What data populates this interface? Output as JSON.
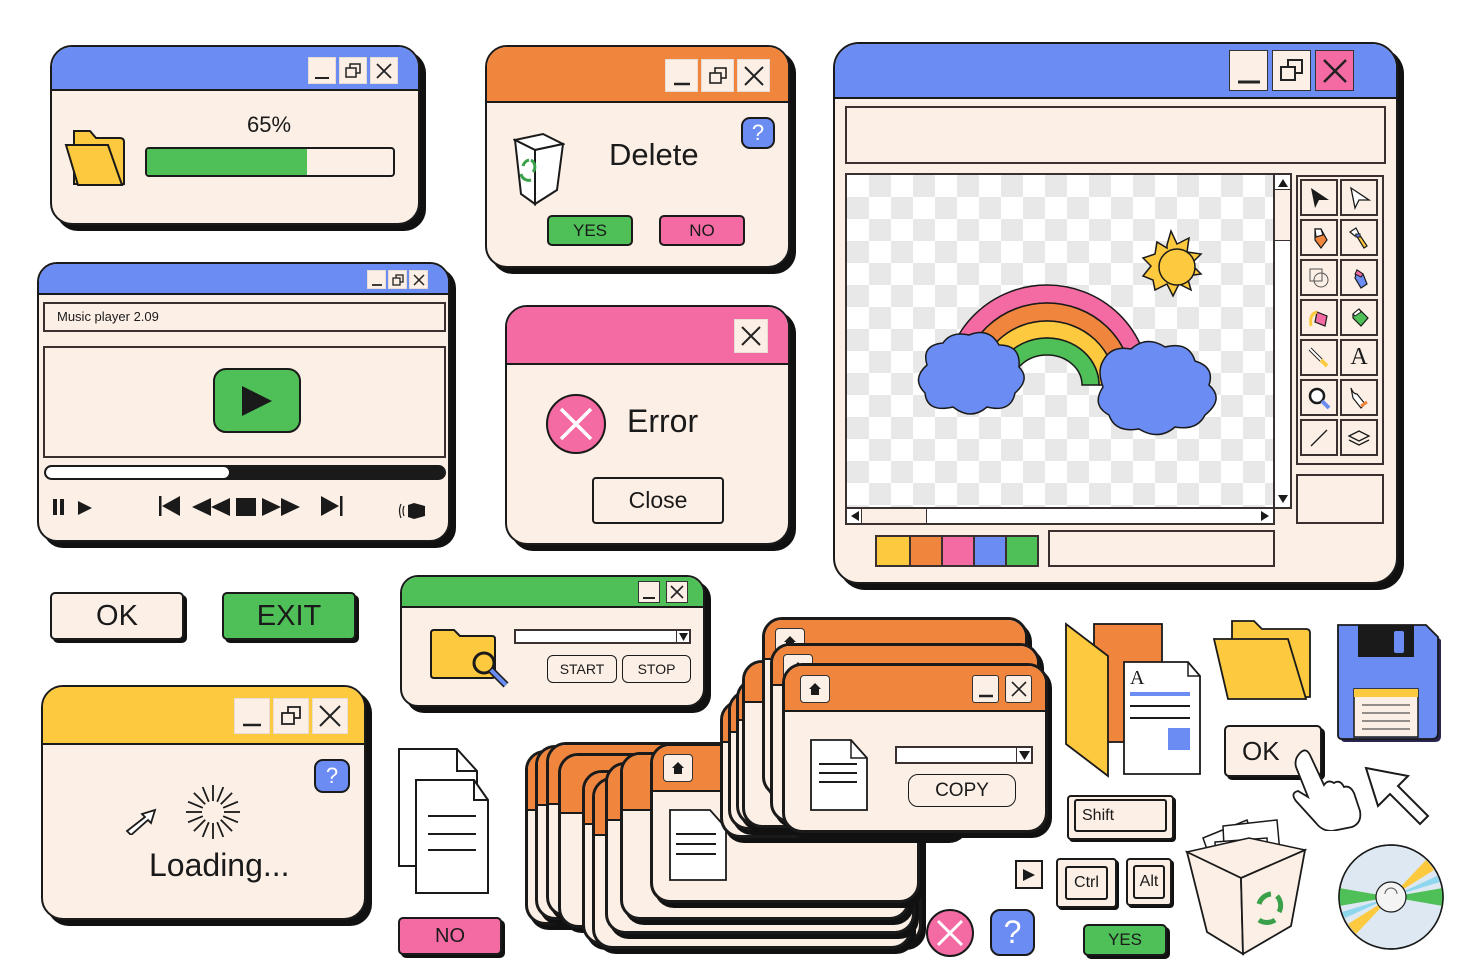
{
  "colors": {
    "blue": "#6b8cf2",
    "orange": "#f0853e",
    "pink": "#f46aa3",
    "yellow": "#fdc93f",
    "green": "#4fbf57",
    "cream": "#fcefe6",
    "outline": "#1a1a1a"
  },
  "progress_window": {
    "title_color": "#6b8cf2",
    "percent_label": "65%",
    "progress_value": 0.65,
    "icon": "folder-icon",
    "controls": [
      "minimize",
      "restore",
      "close"
    ]
  },
  "delete_dialog": {
    "title_color": "#f0853e",
    "message": "Delete",
    "help_label": "?",
    "yes_label": "YES",
    "no_label": "NO",
    "icon": "recycle-bin-icon",
    "controls": [
      "minimize",
      "restore",
      "close"
    ]
  },
  "music_player": {
    "title_color": "#6b8cf2",
    "track_title": "Music player 2.09",
    "progress_value": 0.46,
    "controls": [
      "pause",
      "play",
      "skip-back",
      "rewind",
      "stop",
      "fast-forward",
      "skip-forward",
      "volume"
    ]
  },
  "error_dialog": {
    "title_color": "#f46aa3",
    "message": "Error",
    "close_label": "Close"
  },
  "paint_app": {
    "title_color": "#6b8cf2",
    "canvas_image": "rainbow-with-clouds-and-sun",
    "tools": [
      "select-arrow-filled",
      "select-arrow-outline",
      "eraser",
      "brush",
      "shapes",
      "marker",
      "fill-bucket",
      "eraser-green",
      "pipette",
      "text",
      "zoom",
      "pen",
      "line",
      "layers"
    ],
    "text_tool_label": "A",
    "palette": [
      "#fdc93f",
      "#f0853e",
      "#f46aa3",
      "#6b8cf2",
      "#4fbf57"
    ],
    "horizontal_scroll": 0.0,
    "vertical_scroll": 0.0
  },
  "standalone_buttons": {
    "ok_label": "OK",
    "exit_label": "EXIT",
    "no_label": "NO",
    "yes_label": "YES",
    "ok_click_label": "OK"
  },
  "search_window": {
    "title_color": "#4fbf57",
    "dropdown_value": "",
    "start_label": "START",
    "stop_label": "STOP"
  },
  "loading_window": {
    "title_color": "#fdc93f",
    "message": "Loading...",
    "help_label": "?"
  },
  "copy_window": {
    "title_color": "#f0853e",
    "dropdown_value": "",
    "copy_label": "COPY"
  },
  "keys": {
    "shift": "Shift",
    "ctrl": "Ctrl",
    "alt": "Alt"
  },
  "icons": {
    "help_label": "?",
    "document_letter": "A"
  }
}
